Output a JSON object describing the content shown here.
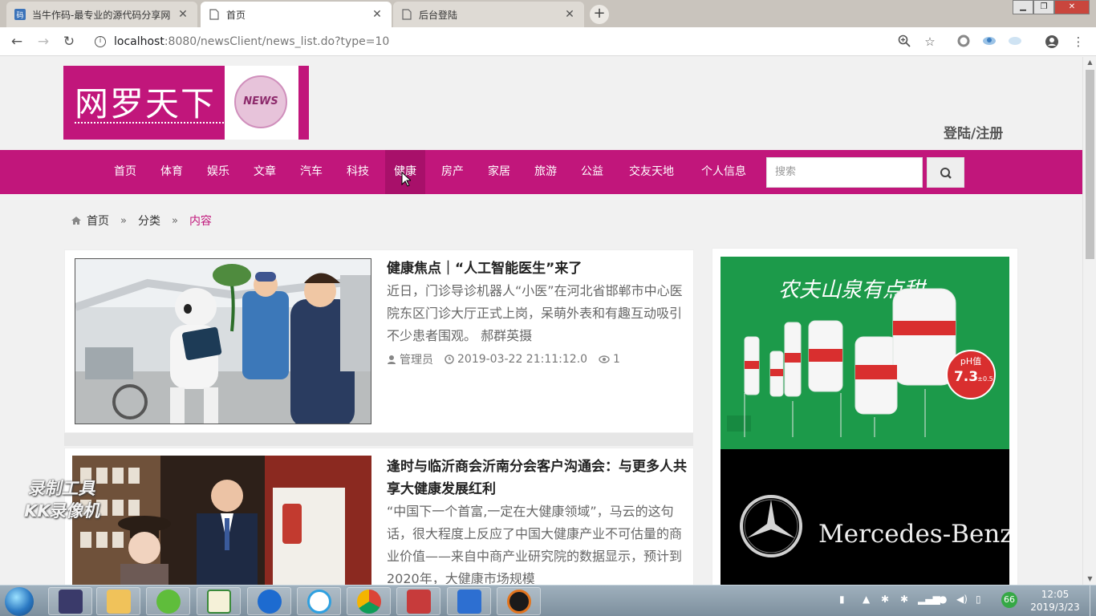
{
  "browser": {
    "tabs": [
      {
        "title": "当牛作码-最专业的源代码分享网",
        "favicon": "logo-square-icon",
        "active": false
      },
      {
        "title": "首页",
        "favicon": "document-icon",
        "active": true
      },
      {
        "title": "后台登陆",
        "favicon": "document-icon",
        "active": false
      }
    ],
    "url_host": "localhost",
    "url_rest": ":8080/newsClient/news_list.do?type=10"
  },
  "site": {
    "logo_text": "网罗天下",
    "logo_badge": "NEWS",
    "login_label": "登陆/注册",
    "nav": [
      "首页",
      "体育",
      "娱乐",
      "文章",
      "汽车",
      "科技",
      "健康",
      "房产",
      "家居",
      "旅游",
      "公益",
      "交友天地",
      "个人信息"
    ],
    "active_nav": "健康",
    "search_placeholder": "搜索",
    "accent_color": "#c1167b"
  },
  "breadcrumb": {
    "home": "首页",
    "sep": "»",
    "category": "分类",
    "current": "内容"
  },
  "articles": [
    {
      "title": "健康焦点｜“人工智能医生”来了",
      "summary": "近日，门诊导诊机器人“小医”在河北省邯郸市中心医院东区门诊大厅正式上岗，呆萌外表和有趣互动吸引不少患者围观。 郝群英摄",
      "author": "管理员",
      "date": "2019-03-22 21:11:12.0",
      "views": "1"
    },
    {
      "title": "逢时与临沂商会沂南分会客户沟通会：与更多人共享大健康发展红利",
      "summary": "“中国下一个首富,一定在大健康领域”，马云的这句话，很大程度上反应了中国大健康产业不可估量的商业价值——来自中商产业研究院的数据显示，预计到2020年，大健康市场规模"
    }
  ],
  "ads": {
    "ad1_text": "农夫山泉有点甜",
    "ad1_badge": "pH值",
    "ad1_ph": "7.3",
    "ad1_ph_tol": "±0.5",
    "ad2_text": "Mercedes-Benz"
  },
  "watermark": [
    "录制工具",
    "KK录像机"
  ],
  "taskbar": {
    "time": "12:05",
    "date": "2019/3/23",
    "tray_badge": "66"
  }
}
